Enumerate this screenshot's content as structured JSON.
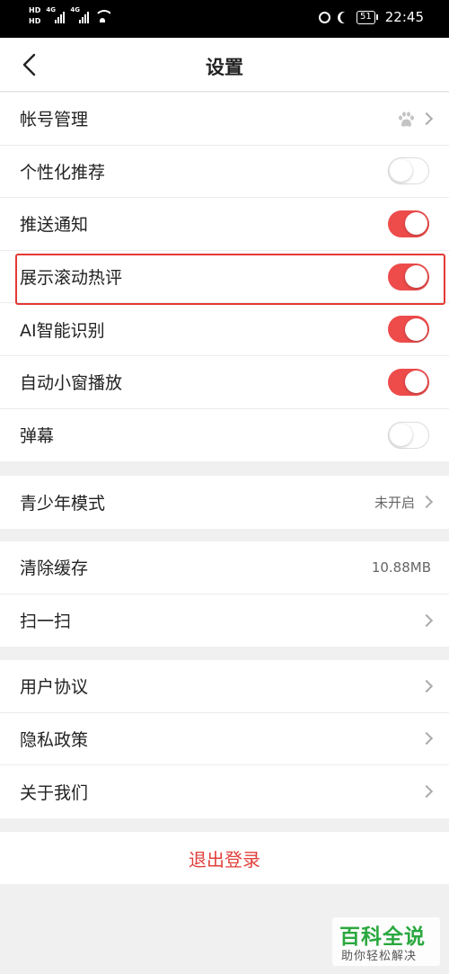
{
  "status_bar": {
    "hd1": "HD",
    "hd2": "HD",
    "net1": "4G",
    "net2": "4G",
    "battery": "51",
    "time": "22:45"
  },
  "header": {
    "title": "设置",
    "back_icon": "chevron-left-icon"
  },
  "groups": [
    {
      "rows": [
        {
          "label": "帐号管理",
          "trailing": "paw-icon",
          "chevron": true
        },
        {
          "label": "个性化推荐",
          "toggle": "off"
        },
        {
          "label": "推送通知",
          "toggle": "on"
        },
        {
          "label": "展示滚动热评",
          "toggle": "on",
          "highlighted": true
        },
        {
          "label": "AI智能识别",
          "toggle": "on"
        },
        {
          "label": "自动小窗播放",
          "toggle": "on"
        },
        {
          "label": "弹幕",
          "toggle": "off"
        }
      ]
    },
    {
      "rows": [
        {
          "label": "青少年模式",
          "value": "未开启",
          "chevron": true
        }
      ]
    },
    {
      "rows": [
        {
          "label": "清除缓存",
          "value": "10.88MB"
        },
        {
          "label": "扫一扫",
          "chevron": true
        }
      ]
    },
    {
      "rows": [
        {
          "label": "用户协议",
          "chevron": true
        },
        {
          "label": "隐私政策",
          "chevron": true
        },
        {
          "label": "关于我们",
          "chevron": true
        }
      ]
    }
  ],
  "logout_label": "退出登录",
  "watermark": {
    "title": "百科全说",
    "subtitle": "助你轻松解决"
  },
  "colors": {
    "accent": "#ee4b4b",
    "highlight_border": "#e53935",
    "logout_text": "#e0403c",
    "watermark_green": "#2aa83f"
  }
}
